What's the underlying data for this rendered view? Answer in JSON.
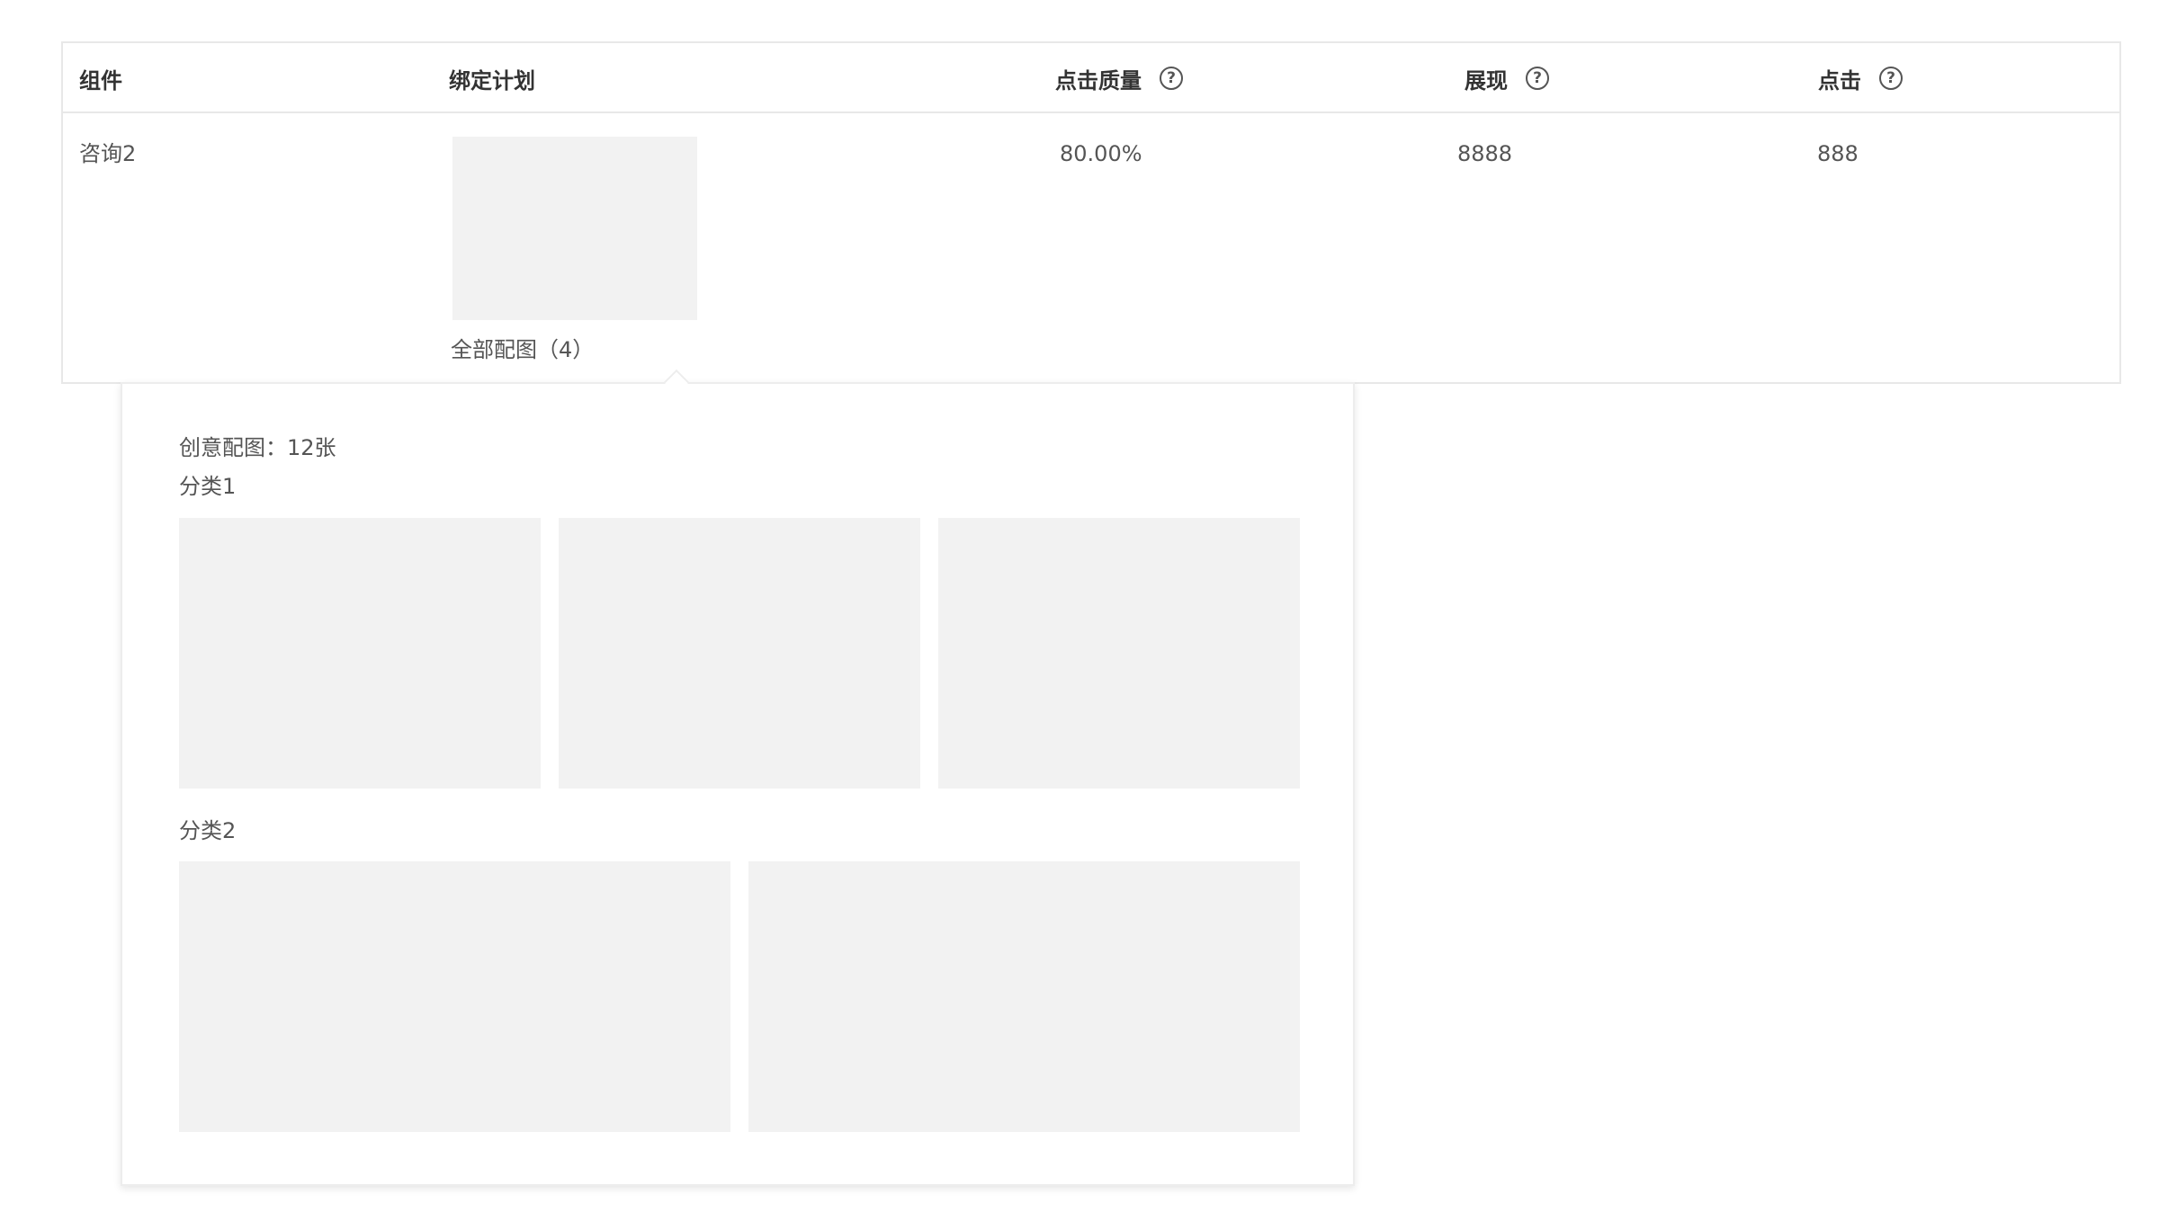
{
  "table": {
    "columns": {
      "component": "组件",
      "plan": "绑定计划",
      "click_quality": "点击质量",
      "impressions": "展现",
      "clicks": "点击"
    },
    "help_icon_glyph": "?",
    "row": {
      "component": "咨询2",
      "click_quality": "80.00%",
      "impressions": "8888",
      "clicks": "888",
      "all_images_link": "全部配图（4）"
    }
  },
  "popover": {
    "title": "创意配图：12张",
    "categories": [
      {
        "label": "分类1",
        "image_count": 3
      },
      {
        "label": "分类2",
        "image_count": 2
      }
    ]
  },
  "colors": {
    "placeholder": "#f2f2f2",
    "border": "#e8e8e8",
    "text": "#555555",
    "header_text": "#333333"
  }
}
